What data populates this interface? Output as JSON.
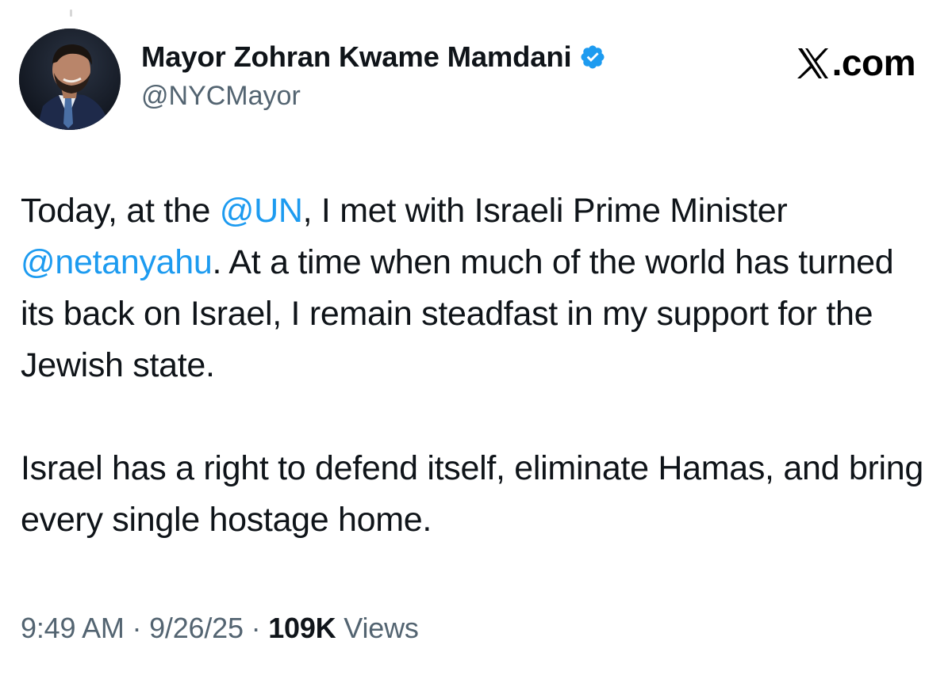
{
  "author": {
    "display_name": "Mayor Zohran Kwame Mamdani",
    "handle": "@NYCMayor",
    "verified_icon": "verified-badge-icon",
    "avatar_icon": "profile-photo"
  },
  "site": {
    "logo_icon": "x-logo-icon",
    "label": ".com"
  },
  "tweet": {
    "p1_seg1": "Today, at the ",
    "p1_mention1": "@UN",
    "p1_seg2": ", I met with Israeli Prime Minister ",
    "p1_mention2": "@netanyahu",
    "p1_seg3": ". At a time when much of the world has turned its back on Israel, I remain steadfast in my support for the Jewish state.",
    "p2": "Israel has a right to defend itself, eliminate Hamas, and bring every single hostage home."
  },
  "meta": {
    "time": "9:49 AM",
    "sep1": " · ",
    "date": "9/26/25",
    "sep2": " · ",
    "views_count": "109K",
    "views_label": " Views"
  },
  "colors": {
    "mention": "#1d9bf0",
    "secondary_text": "#536471",
    "primary_text": "#0f1419",
    "verified": "#1d9bf0"
  }
}
